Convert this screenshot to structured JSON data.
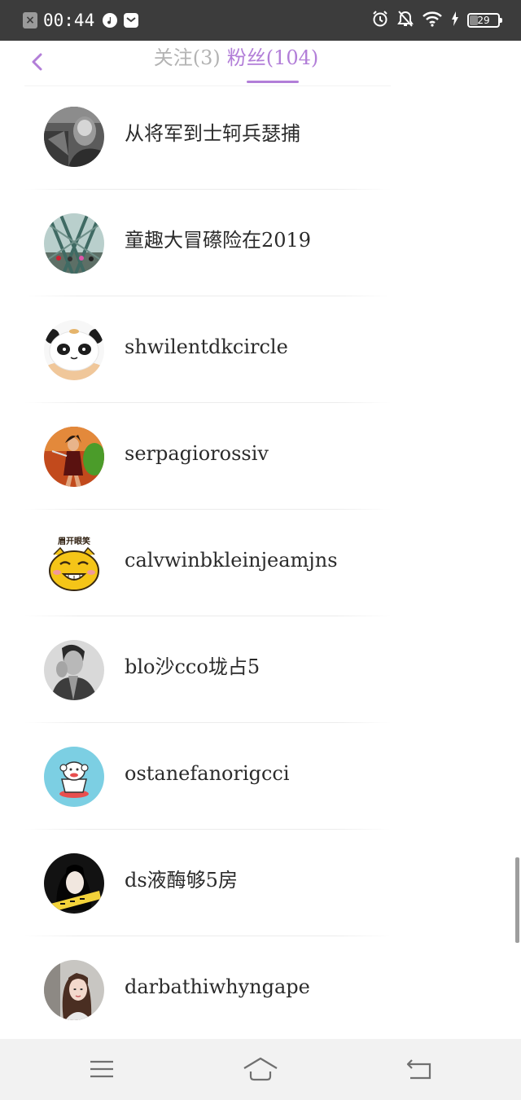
{
  "status_bar": {
    "time": "00:44",
    "battery": "29",
    "battery_level": 0.29,
    "notification_icons": [
      "close-notification-icon",
      "music-app-icon",
      "mail-app-icon"
    ],
    "system_icons": [
      "alarm-icon",
      "silent-bell-icon",
      "wifi-icon",
      "charging-icon",
      "battery-icon"
    ]
  },
  "header": {
    "tabs": [
      {
        "label": "关注(3)",
        "active": false
      },
      {
        "label": "粉丝(104)",
        "active": true
      }
    ]
  },
  "followers": [
    {
      "name": "从将军到士轲兵瑟捕",
      "avatar": "grayscale-girl-photo"
    },
    {
      "name": "童趣大冒礤险在2019",
      "avatar": "stadium-structure-photo"
    },
    {
      "name": "shwilentdkcircle",
      "avatar": "panda-plush-photo"
    },
    {
      "name": "serpagiorossiv",
      "avatar": "fantasy-warrior-art"
    },
    {
      "name": "calvwinbkleinjeamjns",
      "avatar": "yellow-cat-cartoon",
      "avatar_caption": "眉开眼笑"
    },
    {
      "name": "blo沙cco垅占5",
      "avatar": "grayscale-man-photo"
    },
    {
      "name": "ostanefanorigcci",
      "avatar": "cartoon-monkey-cup"
    },
    {
      "name": "ds液酶够5房",
      "avatar": "dark-portrait-banner"
    },
    {
      "name": "darbathiwhyngape",
      "avatar": "woman-portrait-photo"
    }
  ],
  "colors": {
    "accent": "#b27ed8",
    "inactive_tab": "#b3b3b3",
    "status_bar": "#3c3c3c",
    "nav_bar": "#f2f2f2",
    "name_text": "#2b2b2b"
  },
  "nav_bar": {
    "buttons": [
      "menu-icon",
      "home-icon",
      "back-icon"
    ]
  }
}
